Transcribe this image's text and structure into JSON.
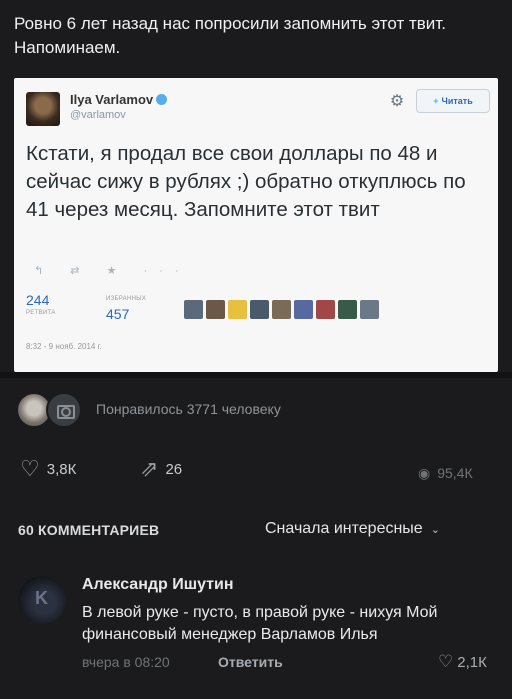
{
  "post": {
    "text": "Ровно 6 лет назад нас попросили запомнить этот твит. Напоминаем."
  },
  "tweet": {
    "name": "Ilya Varlamov",
    "handle": "@varlamov",
    "follow_label": "Читать",
    "body": "Кстати, я продал все свои доллары по 48 и сейчас сижу в рублях ;) обратно откуплюсь по 41 через месяц. Запомните этот твит",
    "retweets": "244",
    "retweets_label": "РЕТВИТА",
    "favorites": "457",
    "favorites_label": "ИЗБРАННЫХ",
    "date": "8:32 - 9 нояб. 2014 г.",
    "faces": [
      "#5a6a7a",
      "#6b5848",
      "#e8c040",
      "#4a5a6a",
      "#7a6a58",
      "#5868a0",
      "#a04848",
      "#385a48",
      "#6a7888"
    ]
  },
  "likes": {
    "text": "Понравилось 3771 человеку"
  },
  "counters": {
    "likes": "3,8К",
    "shares": "26",
    "views": "95,4К"
  },
  "comments": {
    "count_label": "60 КОММЕНТАРИЕВ",
    "sort_label": "Сначала интересные",
    "items": [
      {
        "author": "Александр Ишутин",
        "text": "В левой руке - пусто, в правой руке - нихуя Мой финансовый менеджер Варламов Илья",
        "time": "вчера в 08:20",
        "reply_label": "Ответить",
        "likes": "2,1К"
      }
    ]
  }
}
